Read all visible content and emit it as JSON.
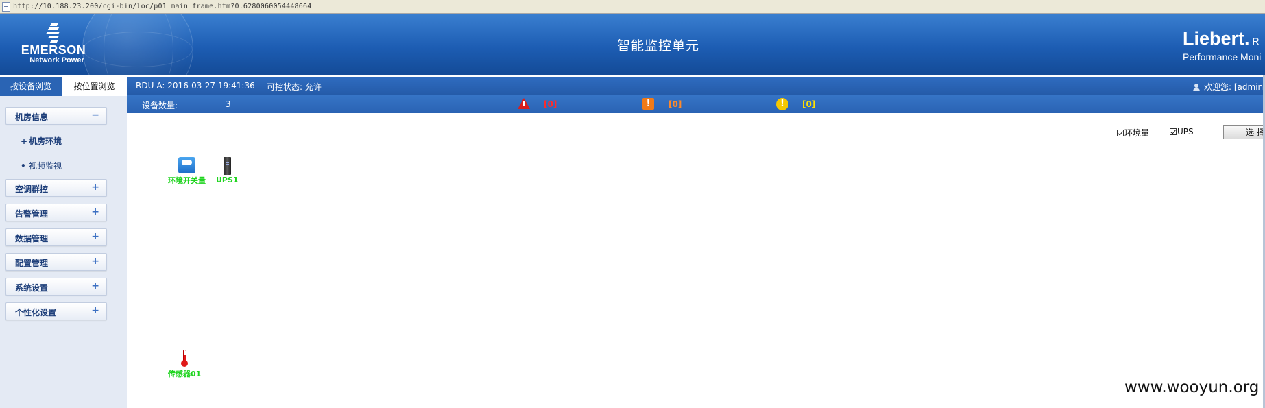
{
  "address_bar": {
    "url": "http://10.188.23.200/cgi-bin/loc/p01_main_frame.htm?0.6280060054448664"
  },
  "header": {
    "left_logo_name": "EMERSON",
    "left_logo_sub": "Network Power",
    "title": "智能监控单元",
    "right_logo_brand": "Liebert.",
    "right_logo_brand_suffix": "R",
    "right_logo_tagline": "Performance Moni"
  },
  "tabs": [
    {
      "label": "按设备浏览",
      "active": false
    },
    {
      "label": "按位置浏览",
      "active": true
    }
  ],
  "infobar": {
    "rdu_text": "RDU-A: 2016-03-27 19:41:36",
    "control_label": "可控状态:",
    "control_value": "允许",
    "welcome": "欢迎您: [admin"
  },
  "summary": {
    "device_count_label": "设备数量:",
    "device_count_value": "3",
    "alarms": [
      {
        "level": "critical",
        "icon": "warning-triangle-icon",
        "count": "[0]",
        "color": "#ff2a2a"
      },
      {
        "level": "major",
        "icon": "exclamation-square-icon",
        "count": "[0]",
        "color": "#ff8a2a"
      },
      {
        "level": "minor",
        "icon": "exclamation-circle-icon",
        "count": "[0]",
        "color": "#ffe000"
      }
    ]
  },
  "sidebar": {
    "sections": [
      {
        "label": "机房信息",
        "sign": "−",
        "expanded": true
      },
      {
        "label": "空调群控",
        "sign": "+"
      },
      {
        "label": "告警管理",
        "sign": "+"
      },
      {
        "label": "数据管理",
        "sign": "+"
      },
      {
        "label": "配置管理",
        "sign": "+"
      },
      {
        "label": "系统设置",
        "sign": "+"
      },
      {
        "label": "个性化设置",
        "sign": "+"
      }
    ],
    "sub_items": [
      {
        "bullet": "+",
        "label": "机房环境"
      },
      {
        "bullet": "•",
        "label": "视频监视"
      }
    ]
  },
  "main": {
    "filters": [
      {
        "label": "环境量",
        "checked": true
      },
      {
        "label": "UPS",
        "checked": true
      }
    ],
    "select_button": "选  择",
    "devices": [
      {
        "label": "环境开关量",
        "icon": "environment-device-icon"
      },
      {
        "label": "UPS1",
        "icon": "ups-device-icon"
      },
      {
        "label": "传感器01",
        "icon": "thermometer-sensor-icon"
      }
    ]
  },
  "watermark": "www.wooyun.org",
  "colors": {
    "header_blue": "#1d5db3",
    "sidebar_bg": "#e4eaf4",
    "device_label_green": "#1fd41f"
  }
}
